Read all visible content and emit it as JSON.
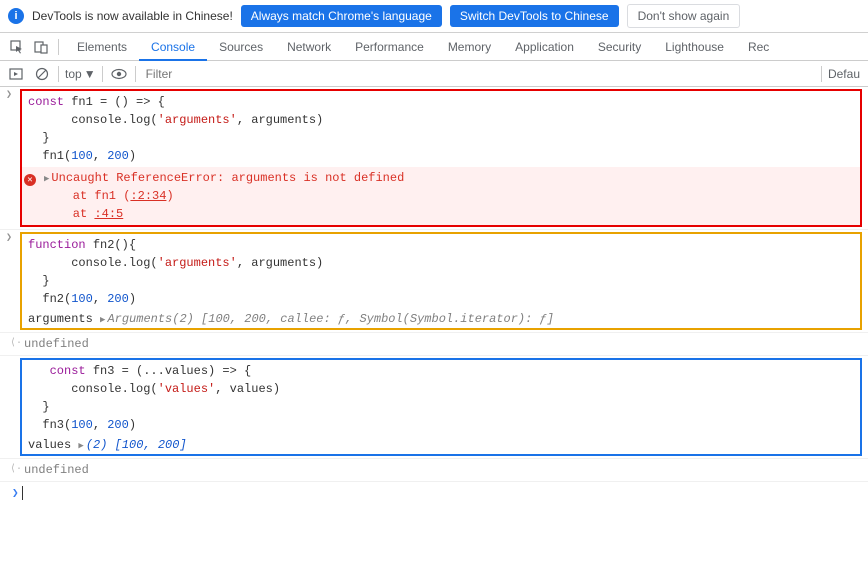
{
  "infobar": {
    "message": "DevTools is now available in Chinese!",
    "btn_match": "Always match Chrome's language",
    "btn_switch": "Switch DevTools to Chinese",
    "btn_dismiss": "Don't show again"
  },
  "tabs": {
    "items": [
      "Elements",
      "Console",
      "Sources",
      "Network",
      "Performance",
      "Memory",
      "Application",
      "Security",
      "Lighthouse",
      "Rec"
    ],
    "active_index": 1
  },
  "toolbar": {
    "top_label": "top",
    "filter_placeholder": "Filter",
    "right_label": "Defau"
  },
  "console_entries": {
    "block1_code_lines": [
      {
        "segs": [
          {
            "t": "const ",
            "c": "kw"
          },
          {
            "t": "fn1 = () => {"
          }
        ]
      },
      {
        "segs": [
          {
            "t": "      console.log("
          },
          {
            "t": "'arguments'",
            "c": "str"
          },
          {
            "t": ", arguments)"
          }
        ]
      },
      {
        "segs": [
          {
            "t": "  }"
          }
        ]
      },
      {
        "segs": [
          {
            "t": "  fn1("
          },
          {
            "t": "100",
            "c": "num"
          },
          {
            "t": ", "
          },
          {
            "t": "200",
            "c": "num"
          },
          {
            "t": ")"
          }
        ]
      }
    ],
    "block1_error_lines": [
      "Uncaught ReferenceError: arguments is not defined",
      "    at fn1 (<anonymous>:2:34)",
      "    at <anonymous>:4:5"
    ],
    "block2_code_lines": [
      {
        "segs": [
          {
            "t": "function ",
            "c": "kw"
          },
          {
            "t": "fn2(){"
          }
        ]
      },
      {
        "segs": [
          {
            "t": "      console.log("
          },
          {
            "t": "'arguments'",
            "c": "str"
          },
          {
            "t": ", arguments)"
          }
        ]
      },
      {
        "segs": [
          {
            "t": "  }"
          }
        ]
      },
      {
        "segs": [
          {
            "t": "  fn2("
          },
          {
            "t": "100",
            "c": "num"
          },
          {
            "t": ", "
          },
          {
            "t": "200",
            "c": "num"
          },
          {
            "t": ")"
          }
        ]
      }
    ],
    "block2_log_label": "arguments",
    "block2_log_preview": "Arguments(2) [100, 200, callee: ƒ, Symbol(Symbol.iterator): ƒ]",
    "undefined_label": "undefined",
    "block3_code_lines": [
      {
        "segs": [
          {
            "t": "   const ",
            "c": "kw"
          },
          {
            "t": "fn3 = (...values) => {"
          }
        ]
      },
      {
        "segs": [
          {
            "t": "      console.log("
          },
          {
            "t": "'values'",
            "c": "str"
          },
          {
            "t": ", values)"
          }
        ]
      },
      {
        "segs": [
          {
            "t": "  }"
          }
        ]
      },
      {
        "segs": [
          {
            "t": "  fn3("
          },
          {
            "t": "100",
            "c": "num"
          },
          {
            "t": ", "
          },
          {
            "t": "200",
            "c": "num"
          },
          {
            "t": ")"
          }
        ]
      }
    ],
    "block3_log_label": "values",
    "block3_log_preview": "(2) [100, 200]"
  }
}
